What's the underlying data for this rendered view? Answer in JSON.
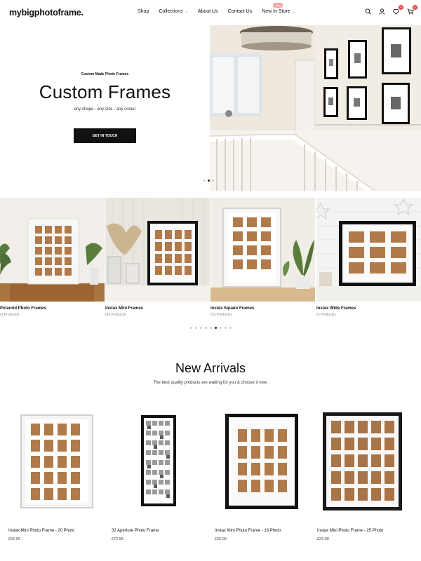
{
  "header": {
    "logo": "mybigphotoframe.",
    "nav": [
      {
        "label": "Shop",
        "has_dropdown": false
      },
      {
        "label": "Collections",
        "has_dropdown": true
      },
      {
        "label": "About Us",
        "has_dropdown": false
      },
      {
        "label": "Contact Us",
        "has_dropdown": false
      },
      {
        "label": "New In Store",
        "has_dropdown": true,
        "badge": "New"
      }
    ],
    "icons": [
      "search-icon",
      "account-icon",
      "wishlist-icon",
      "cart-icon"
    ],
    "wishlist_count": "0",
    "cart_count": "0"
  },
  "hero": {
    "eyebrow": "Custom Made Photo Frames",
    "title": "Custom Frames",
    "subtitle": "any shape - any size - any colour",
    "button": "GET IN TOUCH",
    "slides": 3,
    "active_slide": 2
  },
  "collections": {
    "items": [
      {
        "name": "Polaroid Photo Frames",
        "count": "(3 Products)"
      },
      {
        "name": "Instax Mini Frames",
        "count": "(20 Products)"
      },
      {
        "name": "Instax Square Frames",
        "count": "(10 Products)"
      },
      {
        "name": "Instax Wide Frames",
        "count": "(5 Products)"
      }
    ],
    "pages": 9,
    "active_page": 6
  },
  "new_arrivals": {
    "title": "New Arrivals",
    "subtitle": "The best quality products are waiting for you & choose it now.",
    "products": [
      {
        "name": "Instax Mini Photo Frame - 20 Photo",
        "price": "£22.00"
      },
      {
        "name": "32 Aperture Photo Frame",
        "price": "£72.99"
      },
      {
        "name": "Instax Mini Photo Frame - 16 Photo",
        "price": "£25.00"
      },
      {
        "name": "Instax Mini Photo Frame - 25 Photo",
        "price": "£29.00"
      }
    ]
  },
  "colors": {
    "accent": "#111111",
    "badge": "#f4a3a3",
    "count_badge": "#e8453c",
    "mat_opening": "#b07a4a"
  }
}
